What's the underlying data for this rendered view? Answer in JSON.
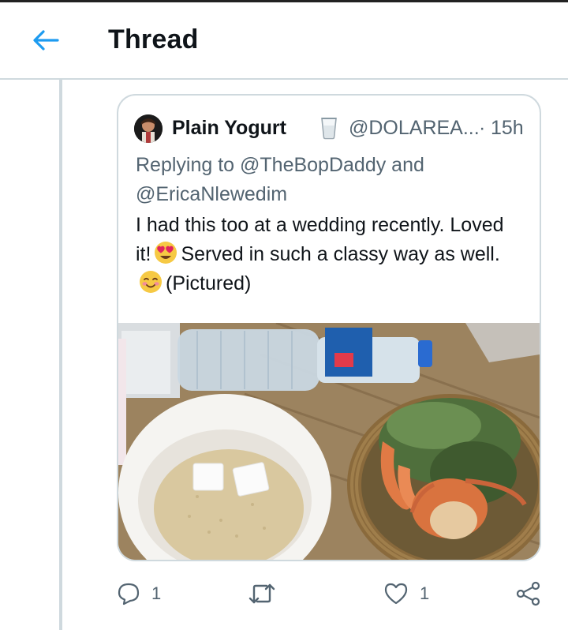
{
  "header": {
    "title": "Thread",
    "back_icon": "arrow-left-icon"
  },
  "quoted_tweet": {
    "author_name": "Plain Yogurt",
    "author_badge_icon": "cup-emoji-icon",
    "author_handle": "@DOLAREA...",
    "separator": "·",
    "timestamp": "15h",
    "replying_to": "Replying to @TheBopDaddy and @EricaNlewedim",
    "text_part1": "I had this too at a wedding recently. Loved it!",
    "text_part2": "Served in such a classy way as well.",
    "text_part3": "(Pictured)",
    "media_alt": "photo of food: bowl of garri with sugar cubes, water bottle, basket of seafood"
  },
  "actions": {
    "reply_icon": "reply-icon",
    "reply_count": "1",
    "retweet_icon": "retweet-icon",
    "like_icon": "heart-icon",
    "like_count": "1",
    "share_icon": "share-icon"
  },
  "colors": {
    "accent": "#1d9bf0",
    "secondary_text": "#536471",
    "border": "#cfd9de"
  }
}
